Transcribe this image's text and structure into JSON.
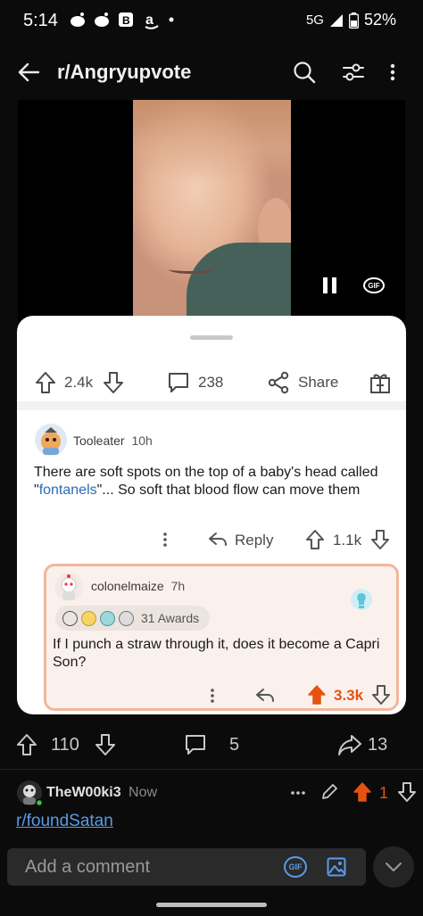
{
  "status_bar": {
    "time": "5:14",
    "network": "5G",
    "battery": "52%"
  },
  "header": {
    "title": "r/Angryupvote"
  },
  "video": {
    "gif_label": "GIF"
  },
  "post_actions": {
    "votes": "2.4k",
    "comments": "238",
    "share": "Share"
  },
  "comment": {
    "author": "Tooleater",
    "time": "10h",
    "body_prefix": "There are soft spots on the top of a baby's head called \"",
    "body_link": "fontanels",
    "body_suffix": "\"... So soft that blood flow can move them",
    "reply_label": "Reply",
    "votes": "1.1k"
  },
  "reply": {
    "author": "colonelmaize",
    "time": "7h",
    "awards": "31 Awards",
    "body": "If I punch a straw through it, does it become a Capri Son?",
    "votes": "3.3k"
  },
  "post_bar": {
    "votes": "110",
    "comments": "5",
    "shares": "13"
  },
  "lower_comment": {
    "author": "TheW00ki3",
    "time": "Now",
    "votes": "1",
    "link": "r/foundSatan"
  },
  "input": {
    "placeholder": "Add a comment",
    "gif_label": "GIF"
  },
  "colors": {
    "upvote": "#e8520f",
    "link": "#2a6ab8",
    "reply_border": "#f2b79b"
  }
}
